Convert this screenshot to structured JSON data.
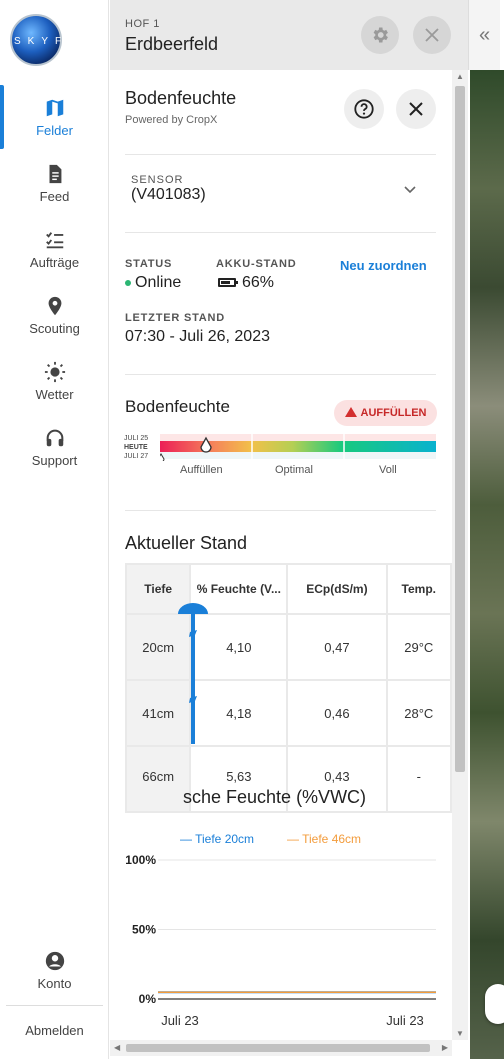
{
  "nav": {
    "logo_text": "SKYFLD",
    "items": [
      {
        "label": "Felder",
        "icon": "map-icon",
        "active": true
      },
      {
        "label": "Feed",
        "icon": "document-icon",
        "active": false
      },
      {
        "label": "Aufträge",
        "icon": "checklist-icon",
        "active": false
      },
      {
        "label": "Scouting",
        "icon": "location-pin-icon",
        "active": false
      },
      {
        "label": "Wetter",
        "icon": "sun-icon",
        "active": false
      },
      {
        "label": "Support",
        "icon": "headset-icon",
        "active": false
      }
    ],
    "account_label": "Konto",
    "logout_label": "Abmelden"
  },
  "header": {
    "farm": "HOF 1",
    "field": "Erdbeerfeld",
    "collapse_glyph": "«"
  },
  "panel": {
    "title": "Bodenfeuchte",
    "powered_by": "Powered by CropX",
    "sensor": {
      "label": "SENSOR",
      "value": "(V401083)"
    },
    "status": {
      "label": "STATUS",
      "value": "Online"
    },
    "battery": {
      "label": "AKKU-STAND",
      "value": "66%"
    },
    "reassign_label": "Neu zuordnen",
    "last_update": {
      "label": "LETZTER STAND",
      "value": "07:30 - Juli 26, 2023"
    },
    "moisture": {
      "title": "Bodenfeuchte",
      "badge": "AUFFÜLLEN",
      "dates": [
        "JULI 25",
        "HEUTE",
        "JULI 27"
      ],
      "scale_labels": [
        "Auffüllen",
        "Optimal",
        "Voll"
      ]
    },
    "current": {
      "title": "Aktueller Stand",
      "columns": [
        "Tiefe",
        "% Feuchte (V...",
        "ECp(dS/m)",
        "Temp."
      ],
      "rows": [
        [
          "20cm",
          "4,10",
          "0,47",
          "29°C"
        ],
        [
          "41cm",
          "4,18",
          "0,46",
          "28°C"
        ],
        [
          "66cm",
          "5,63",
          "0,43",
          "-"
        ]
      ]
    },
    "history_title": "sche Feuchte (%VWC)"
  },
  "chart_data": {
    "type": "line",
    "title": "",
    "series": [
      {
        "name": "Tiefe 20cm",
        "color": "#1a7fd8",
        "x": [
          "Juli 23",
          "Juli 23"
        ],
        "values": [
          4.1,
          4.1
        ]
      },
      {
        "name": "Tiefe 46cm",
        "color": "#f39c3c",
        "x": [
          "Juli 23",
          "Juli 23"
        ],
        "values": [
          4.18,
          4.18
        ]
      }
    ],
    "x_tick_labels": [
      "Juli 23",
      "Juli 23"
    ],
    "y_tick_labels": [
      "100%",
      "50%",
      "0%"
    ],
    "ylim": [
      0,
      100
    ],
    "grid": true,
    "legend": "top"
  }
}
